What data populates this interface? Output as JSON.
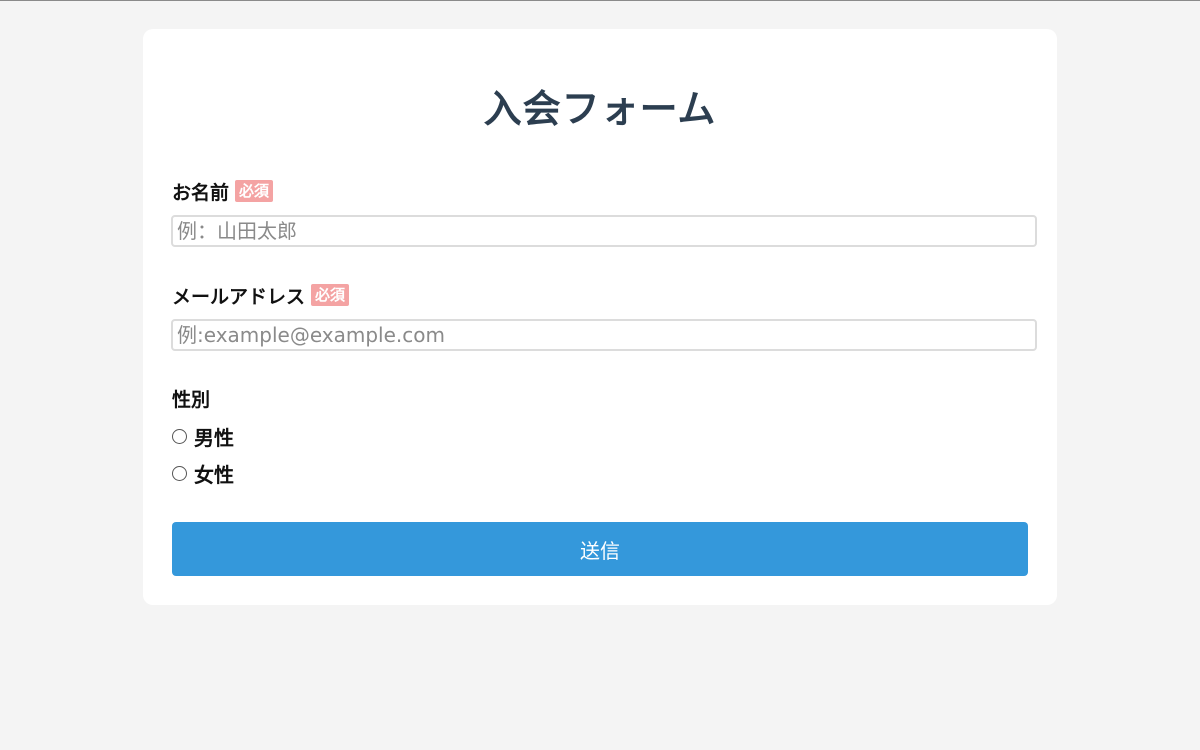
{
  "form": {
    "title": "入会フォーム",
    "required_badge": "必須",
    "name": {
      "label": "お名前",
      "placeholder": "例：山田太郎",
      "value": ""
    },
    "email": {
      "label": "メールアドレス",
      "placeholder": "例:example@example.com",
      "value": ""
    },
    "gender": {
      "label": "性別",
      "options": [
        "男性",
        "女性"
      ],
      "selected": null
    },
    "submit_label": "送信"
  },
  "colors": {
    "background": "#f4f4f4",
    "card": "#ffffff",
    "title": "#2c3e50",
    "required_badge": "#f4a3a3",
    "submit_button": "#3498db"
  }
}
